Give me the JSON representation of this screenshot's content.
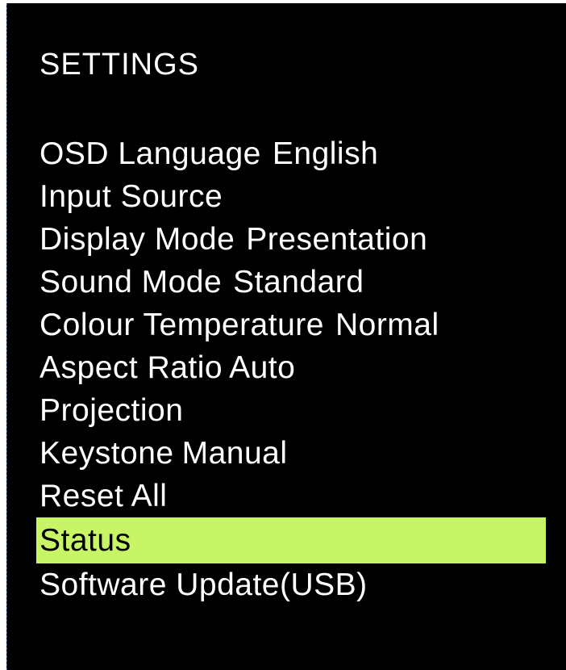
{
  "osd": {
    "title": "SETTINGS",
    "highlight_color": "#c8f566",
    "items": [
      {
        "label": "OSD Language",
        "value": "English"
      },
      {
        "label": "Input Source",
        "value": ""
      },
      {
        "label": "Display Mode",
        "value": "Presentation"
      },
      {
        "label": "Sound Mode",
        "value": "Standard"
      },
      {
        "label": "Colour Temperature",
        "value": "Normal"
      },
      {
        "label": "Aspect Ratio",
        "value": "Auto"
      },
      {
        "label": "Projection",
        "value": ""
      },
      {
        "label": "Keystone",
        "value": "Manual"
      },
      {
        "label": "Reset All",
        "value": ""
      },
      {
        "label": "Status",
        "value": "",
        "selected": true
      },
      {
        "label": "Software Update(USB)",
        "value": ""
      }
    ]
  }
}
